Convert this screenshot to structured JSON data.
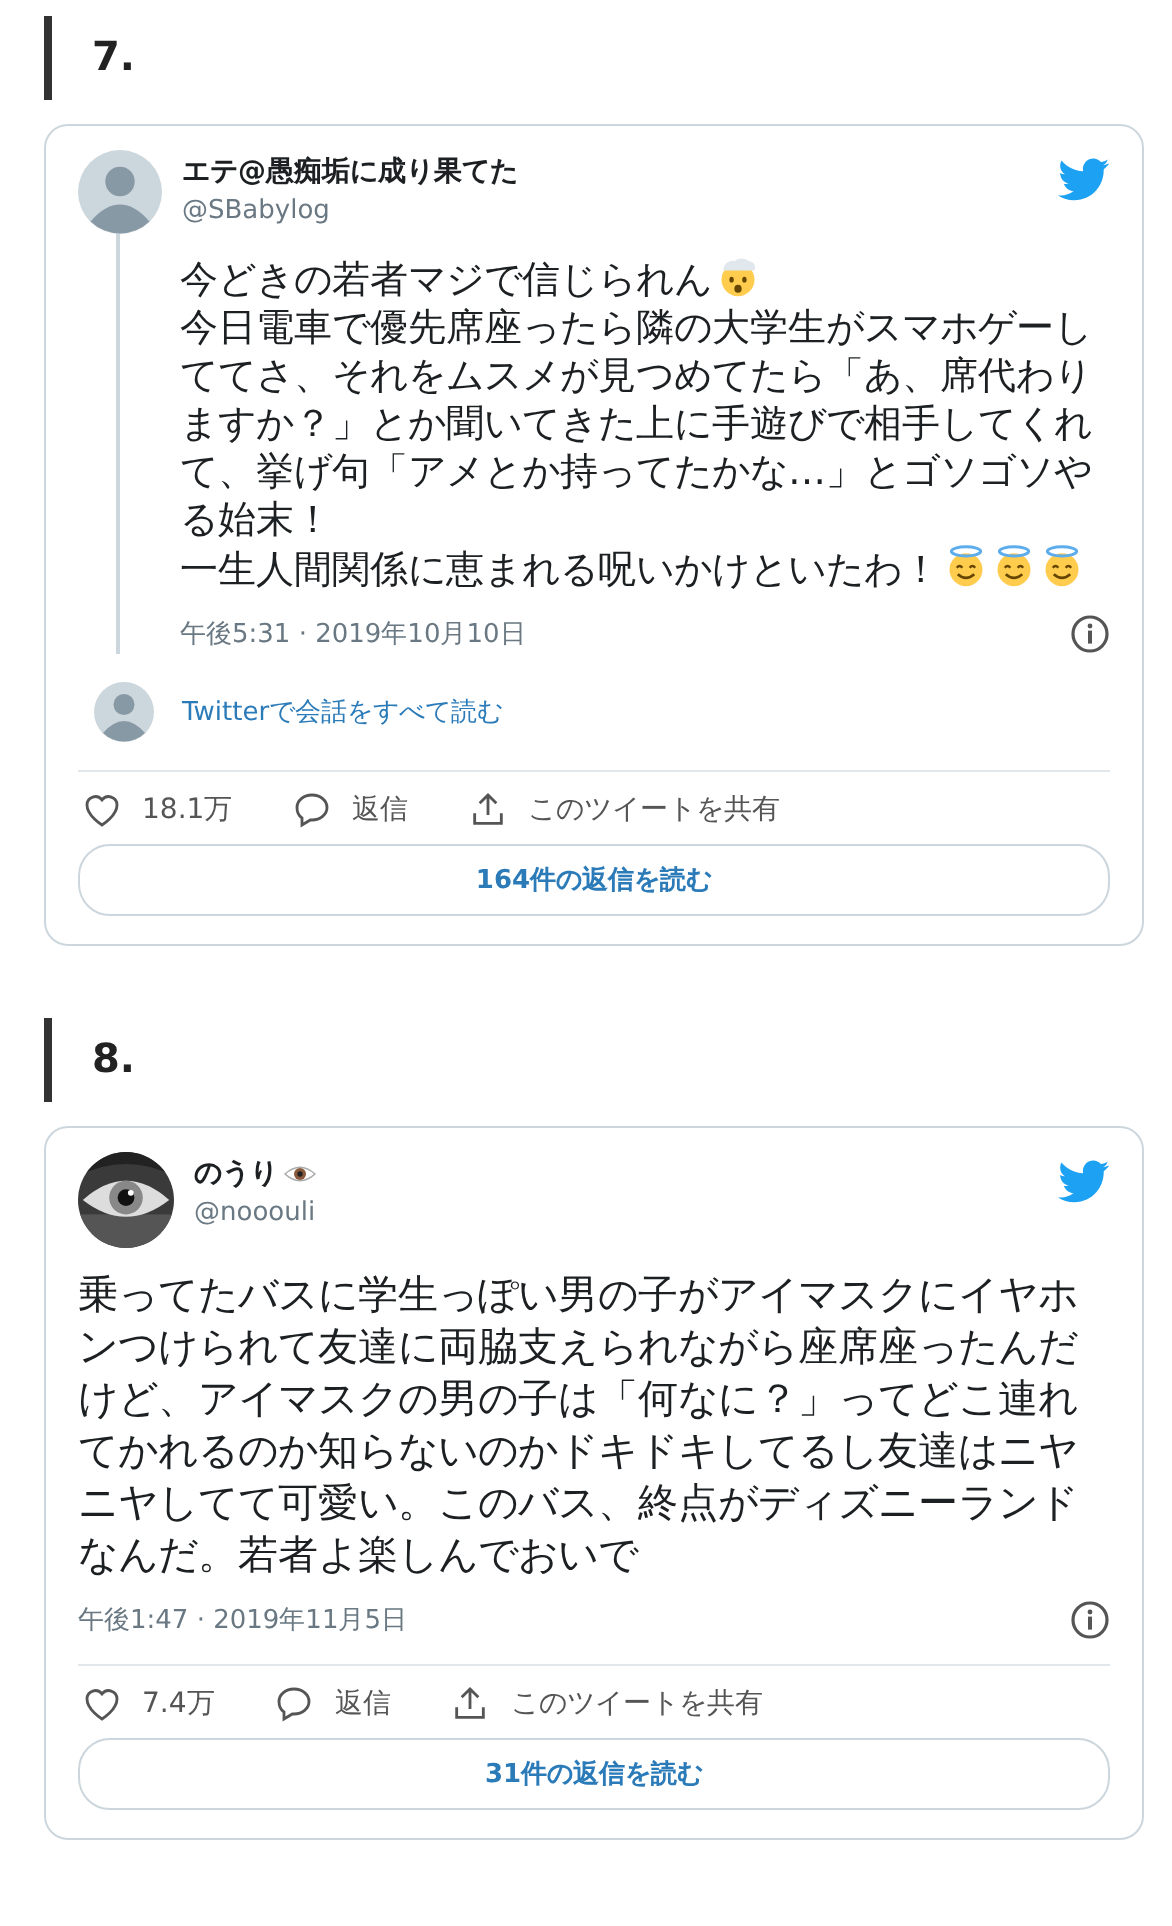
{
  "sections": [
    {
      "number": "7.",
      "tweet": {
        "author": {
          "name": "エテ@愚痴垢に成り果てた",
          "handle": "@SBabylog",
          "avatar": {
            "kind": "silhouette"
          }
        },
        "threaded": true,
        "body": [
          {
            "text": "今どきの若者マジで信じられん",
            "emoji": [
              {
                "kind": "exploding_head"
              }
            ]
          },
          {
            "text": "今日電車で優先席座ったら隣の大学生がスマホゲーしててさ、それをムスメが見つめてたら「あ、席代わりますか？」とか聞いてきた上に手遊びで相手してくれて、挙げ句「アメとか持ってたかな…」とゴソゴソやる始末！"
          },
          {
            "text": "一生人間関係に恵まれる呪いかけといたわ！",
            "emoji": [
              {
                "kind": "halo"
              },
              {
                "kind": "halo"
              },
              {
                "kind": "halo"
              }
            ]
          }
        ],
        "timestamp": "午後5:31 · 2019年10月10日",
        "thread_link": {
          "text": "Twitterで会話をすべて読む",
          "avatar": {
            "kind": "silhouette"
          }
        },
        "likes": "18.1万",
        "reply_label": "返信",
        "share_label": "このツイートを共有",
        "replies_button": "164件の返信を読む"
      }
    },
    {
      "number": "8.",
      "tweet": {
        "author": {
          "name": "のうり",
          "name_emoji": [
            {
              "kind": "eye"
            }
          ],
          "handle": "@nooouli"
        },
        "threaded": false,
        "body": [
          {
            "text": "乗ってたバスに学生っぽい男の子がアイマスクにイヤホンつけられて友達に両脇支えられながら座席座ったんだけど、アイマスクの男の子は「何なに？」ってどこ連れてかれるのか知らないのかドキドキしてるし友達はニヤニヤしてて可愛い。このバス、終点がディズニーランドなんだ。若者よ楽しんでおいで"
          }
        ],
        "timestamp": "午後1:47 · 2019年11月5日",
        "likes": "7.4万",
        "reply_label": "返信",
        "share_label": "このツイートを共有",
        "replies_button": "31件の返信を読む"
      }
    }
  ]
}
